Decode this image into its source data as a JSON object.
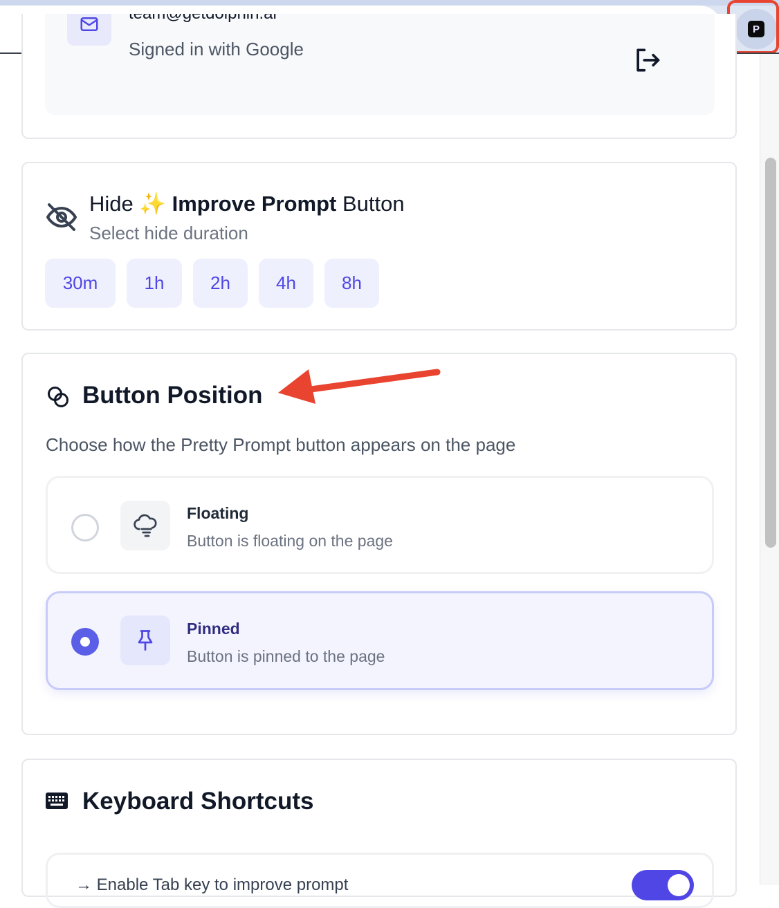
{
  "account": {
    "email": "team@getdolphin.ai",
    "signin_method": "Signed in with Google"
  },
  "hide_section": {
    "title_prefix": "Hide",
    "title_emoji": "✨",
    "title_bold": "Improve Prompt",
    "title_suffix": "Button",
    "subtitle": "Select hide duration",
    "durations": [
      "30m",
      "1h",
      "2h",
      "4h",
      "8h"
    ]
  },
  "position_section": {
    "title": "Button Position",
    "description": "Choose how the Pretty Prompt button appears on the page",
    "options": [
      {
        "title": "Floating",
        "subtitle": "Button is floating on the page",
        "selected": false,
        "icon": "cloud-icon"
      },
      {
        "title": "Pinned",
        "subtitle": "Button is pinned to the page",
        "selected": true,
        "icon": "pin-icon"
      }
    ]
  },
  "keyboard_section": {
    "title": "Keyboard Shortcuts",
    "first_row_label": "→ Enable Tab key to improve prompt",
    "toggle_on": true
  },
  "browser": {
    "extension_letter": "P"
  },
  "colors": {
    "accent": "#4f46e5",
    "annotation": "#e8442f"
  }
}
